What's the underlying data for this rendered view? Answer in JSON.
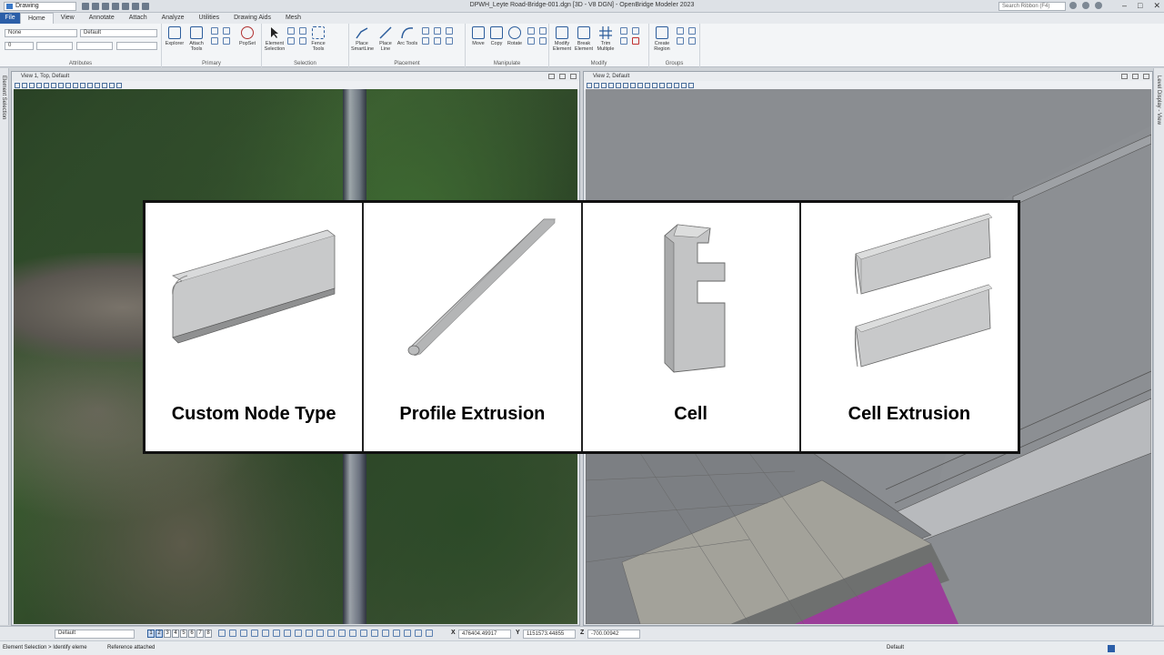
{
  "titlebar": {
    "workspace": "Drawing",
    "title": "DPWH_Leyte Road-Bridge-001.dgn [3D - V8 DGN] - OpenBridge Modeler 2023",
    "search_placeholder": "Search Ribbon (F4)"
  },
  "ribbon_tabs": [
    "File",
    "Home",
    "View",
    "Annotate",
    "Attach",
    "Analyze",
    "Utilities",
    "Drawing Aids",
    "Mesh"
  ],
  "ribbon": {
    "attributes": {
      "level": "None",
      "style": "Default",
      "weight": "0",
      "label": "Attributes"
    },
    "primary": {
      "label": "Primary",
      "buttons": [
        "Explorer",
        "Attach Tools",
        "PopSet"
      ]
    },
    "selection": {
      "label": "Selection",
      "buttons": [
        "Element Selection",
        "Fence Tools"
      ]
    },
    "placement": {
      "label": "Placement",
      "buttons": [
        "Place SmartLine",
        "Place Line",
        "Arc Tools"
      ]
    },
    "manipulate": {
      "label": "Manipulate",
      "buttons": [
        "Move",
        "Copy",
        "Rotate"
      ]
    },
    "modify": {
      "label": "Modify",
      "buttons": [
        "Modify Element",
        "Break Element",
        "Trim Multiple"
      ]
    },
    "groups": {
      "label": "Groups",
      "buttons": [
        "Create Region"
      ]
    }
  },
  "side": {
    "left_label": "Element Selection",
    "right_label": "Level Display - View"
  },
  "views": {
    "view1_title": "View 1, Top, Default",
    "view2_title": "View 2, Default"
  },
  "overlay": {
    "items": [
      {
        "caption": "Custom Node Type",
        "icon": "custom-node-block"
      },
      {
        "caption": "Profile Extrusion",
        "icon": "profile-rod"
      },
      {
        "caption": "Cell",
        "icon": "cell-bracket"
      },
      {
        "caption": "Cell Extrusion",
        "icon": "cell-extrusion-bars"
      }
    ]
  },
  "statusbar": {
    "level_combo": "Default",
    "view_numbers": [
      "1",
      "2",
      "3",
      "4",
      "5",
      "6",
      "7",
      "8"
    ],
    "x_label": "X",
    "x_value": "476404.49917",
    "y_label": "Y",
    "y_value": "1151573.44855",
    "z_label": "Z",
    "z_value": "-700.00942",
    "prompt": "Element Selection > Identify eleme",
    "message": "Reference attached",
    "active_level": "Default"
  }
}
